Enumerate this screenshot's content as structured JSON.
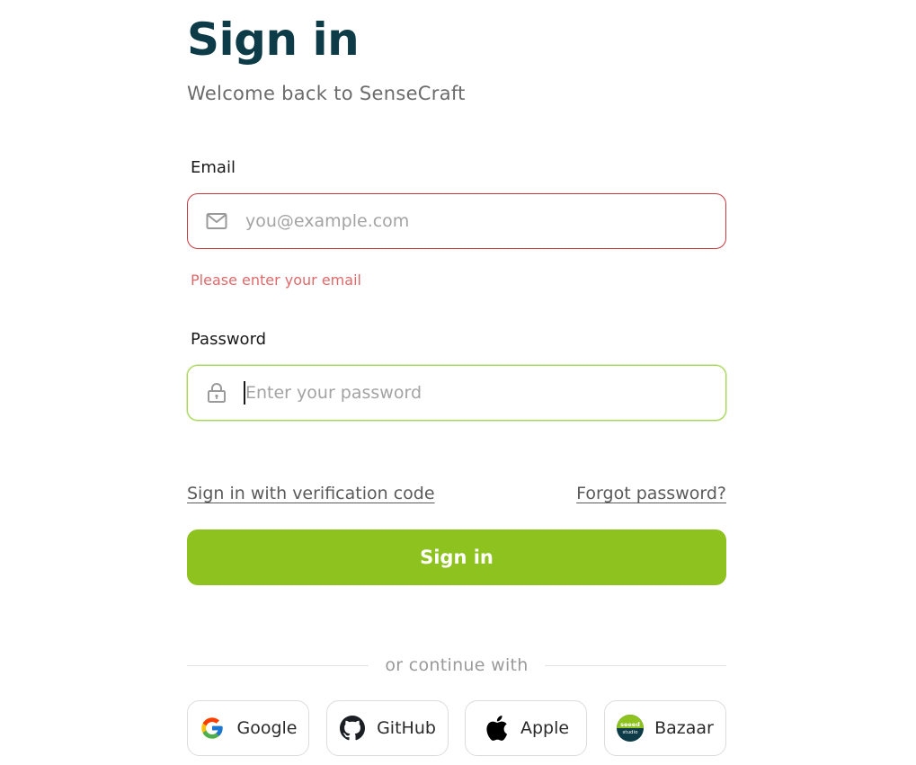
{
  "header": {
    "title": "Sign in",
    "subtitle": "Welcome back to SenseCraft"
  },
  "email": {
    "label": "Email",
    "placeholder": "you@example.com",
    "value": "",
    "error": "Please enter your email",
    "icon": "mail-icon"
  },
  "password": {
    "label": "Password",
    "placeholder": "Enter your password",
    "value": "",
    "icon": "lock-icon"
  },
  "links": {
    "verification": "Sign in with verification code",
    "forgot": "Forgot password?"
  },
  "submit": {
    "label": "Sign in"
  },
  "divider": {
    "text": "or continue with"
  },
  "social": {
    "google": "Google",
    "github": "GitHub",
    "apple": "Apple",
    "bazaar": "Bazaar",
    "bazaar_logo_text": "seeed studio"
  },
  "colors": {
    "title": "#0d3b48",
    "primary": "#8dc21f",
    "error": "#c9383f",
    "error_text": "#e06a6a",
    "focus": "#a5d654"
  }
}
